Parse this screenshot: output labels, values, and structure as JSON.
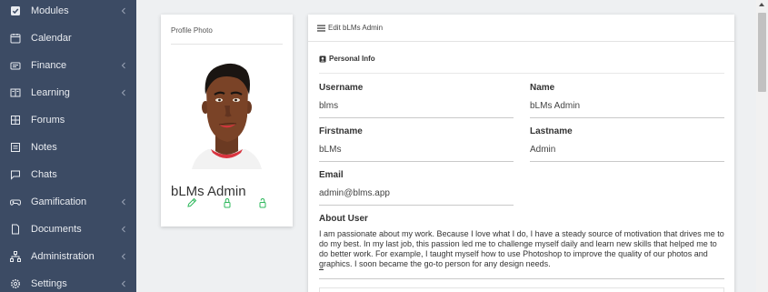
{
  "sidebar": {
    "items": [
      {
        "label": "Modules",
        "icon": "check-square-icon",
        "has_submenu": true
      },
      {
        "label": "Calendar",
        "icon": "calendar-icon",
        "has_submenu": false
      },
      {
        "label": "Finance",
        "icon": "money-icon",
        "has_submenu": true
      },
      {
        "label": "Learning",
        "icon": "book-icon",
        "has_submenu": true
      },
      {
        "label": "Forums",
        "icon": "grid-icon",
        "has_submenu": false
      },
      {
        "label": "Notes",
        "icon": "note-icon",
        "has_submenu": false
      },
      {
        "label": "Chats",
        "icon": "chat-icon",
        "has_submenu": false
      },
      {
        "label": "Gamification",
        "icon": "gamepad-icon",
        "has_submenu": true
      },
      {
        "label": "Documents",
        "icon": "document-icon",
        "has_submenu": true
      },
      {
        "label": "Administration",
        "icon": "sitemap-icon",
        "has_submenu": true
      },
      {
        "label": "Settings",
        "icon": "gear-icon",
        "has_submenu": true
      }
    ]
  },
  "profile": {
    "header": "Profile Photo",
    "name": "bLMs Admin",
    "actions": [
      "edit-icon",
      "lock-icon",
      "unlock-icon"
    ]
  },
  "edit": {
    "header": "Edit bLMs Admin",
    "section_title": "Personal Info",
    "fields": {
      "username": {
        "label": "Username",
        "value": "blms"
      },
      "name": {
        "label": "Name",
        "value": "bLMs Admin"
      },
      "firstname": {
        "label": "Firstname",
        "value": "bLMs"
      },
      "lastname": {
        "label": "Lastname",
        "value": "Admin"
      },
      "email": {
        "label": "Email",
        "value": "admin@blms.app"
      }
    },
    "about": {
      "label": "About User",
      "text": "I am passionate about my work. Because I love what I do, I have a steady source of motivation that drives me to do my best. In my last job, this passion led me to challenge myself daily and learn new skills that helped me to do better work. For example, I taught myself how to use Photoshop to improve the quality of our photos and graphics. I soon became the go-to person for any design needs."
    }
  },
  "colors": {
    "sidebar_bg": "#3c4b64",
    "sidebar_text": "#e8ebf0",
    "page_bg": "#eef0f2",
    "accent_green": "#2eb85c"
  }
}
